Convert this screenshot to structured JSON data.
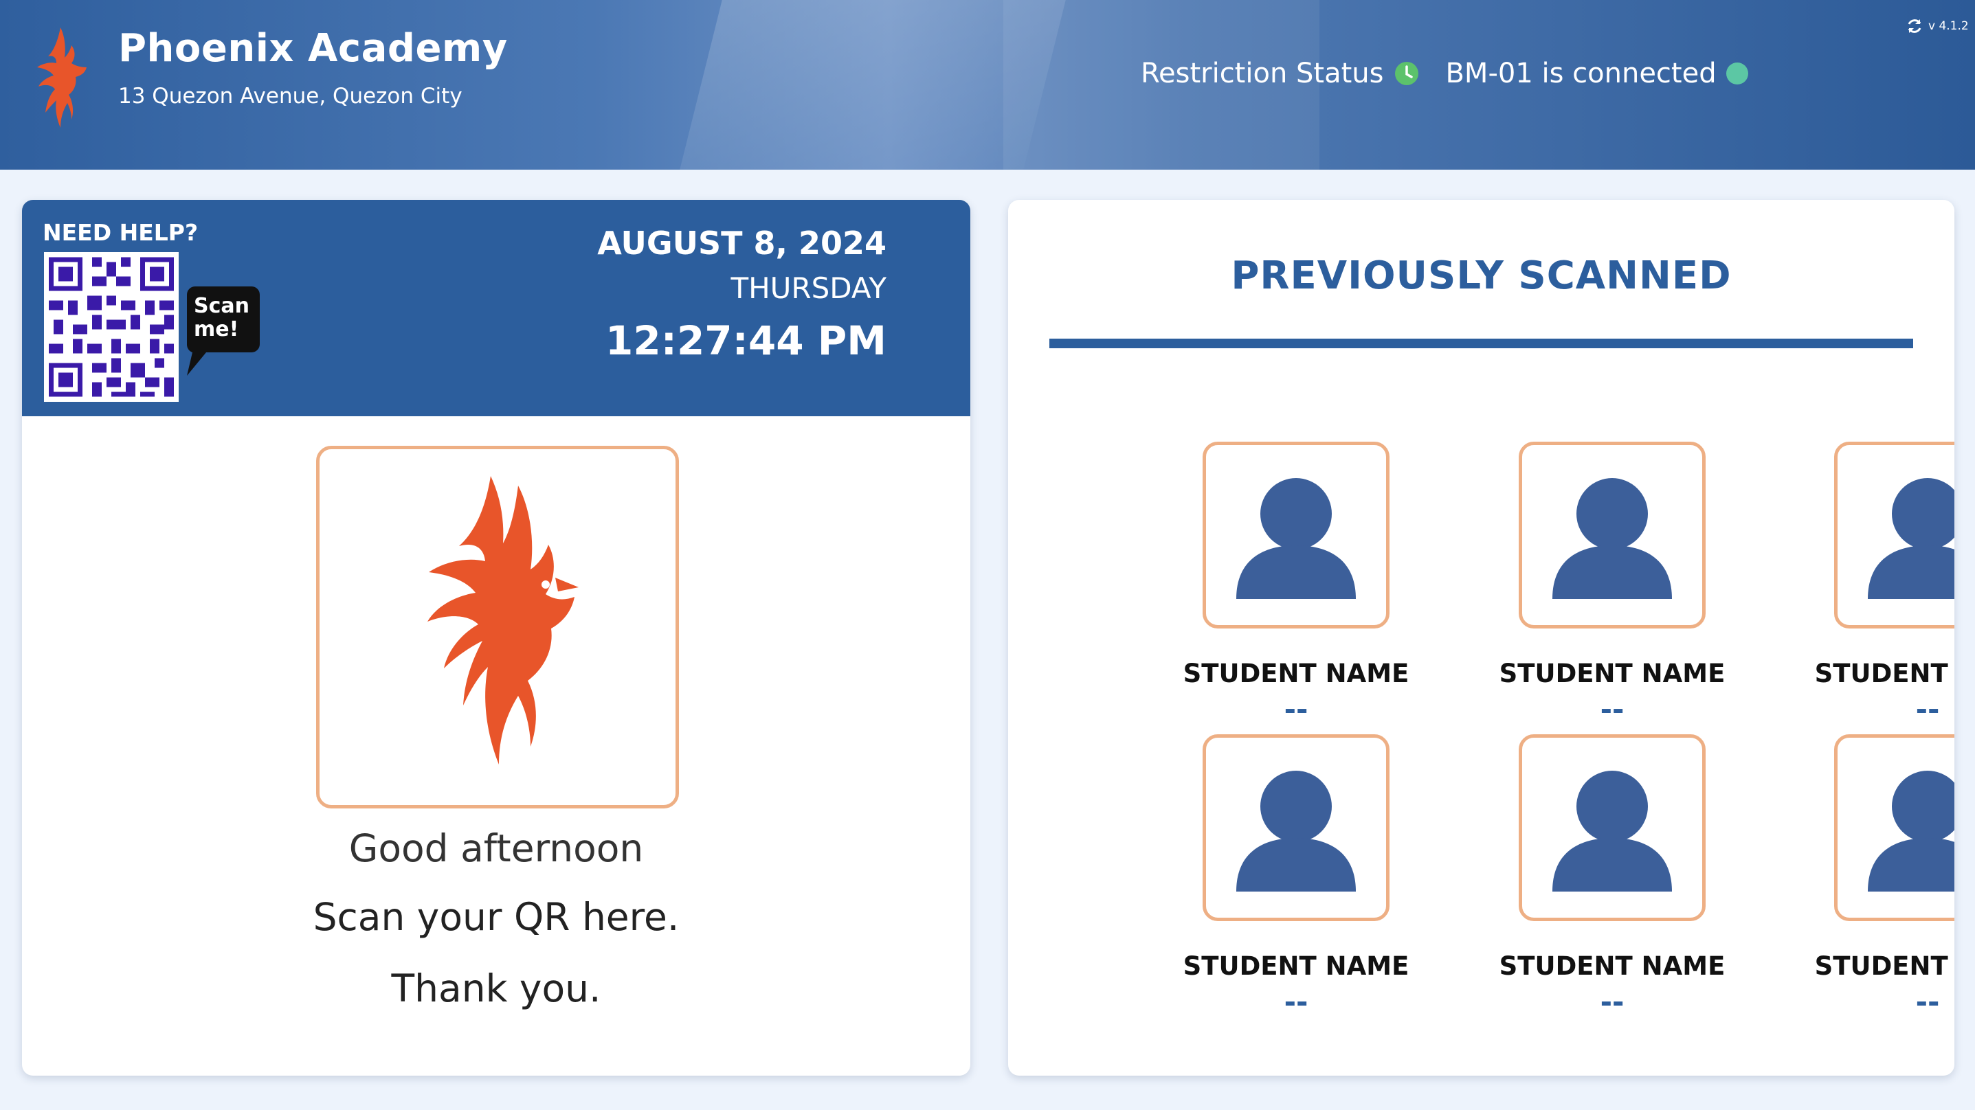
{
  "header": {
    "school_name": "Phoenix Academy",
    "school_address": "13 Quezon Avenue, Quezon City",
    "restriction_status_label": "Restriction Status",
    "connection_status": "BM-01 is connected",
    "version": "v 4.1.2",
    "status_colors": {
      "restriction": "#5cc26b",
      "connection": "#5cc7a4"
    }
  },
  "info_panel": {
    "help_label": "NEED HELP?",
    "scan_me_label": "Scan me!",
    "date": "AUGUST 8, 2024",
    "day": "THURSDAY",
    "time": "12:27:44 PM"
  },
  "greeting": {
    "line1": "Good afternoon",
    "line2": "Scan your QR here.",
    "line3": "Thank you."
  },
  "previously_scanned": {
    "title": "PREVIOUSLY SCANNED",
    "students": [
      {
        "name": "STUDENT NAME",
        "detail": "--"
      },
      {
        "name": "STUDENT NAME",
        "detail": "--"
      },
      {
        "name": "STUDENT NAME",
        "detail": "--"
      },
      {
        "name": "STUDENT NAME",
        "detail": "--"
      },
      {
        "name": "STUDENT NAME",
        "detail": "--"
      },
      {
        "name": "STUDENT NAME",
        "detail": "--"
      }
    ]
  },
  "colors": {
    "brand_blue": "#2c5e9d",
    "brand_orange": "#e8552a",
    "frame_border": "#eeaf84",
    "avatar": "#3c5f9a"
  },
  "icons": [
    "phoenix-logo-icon",
    "clock-icon",
    "status-dot-icon",
    "sync-icon",
    "qr-code-icon",
    "scan-me-bubble-icon",
    "avatar-placeholder-icon"
  ]
}
